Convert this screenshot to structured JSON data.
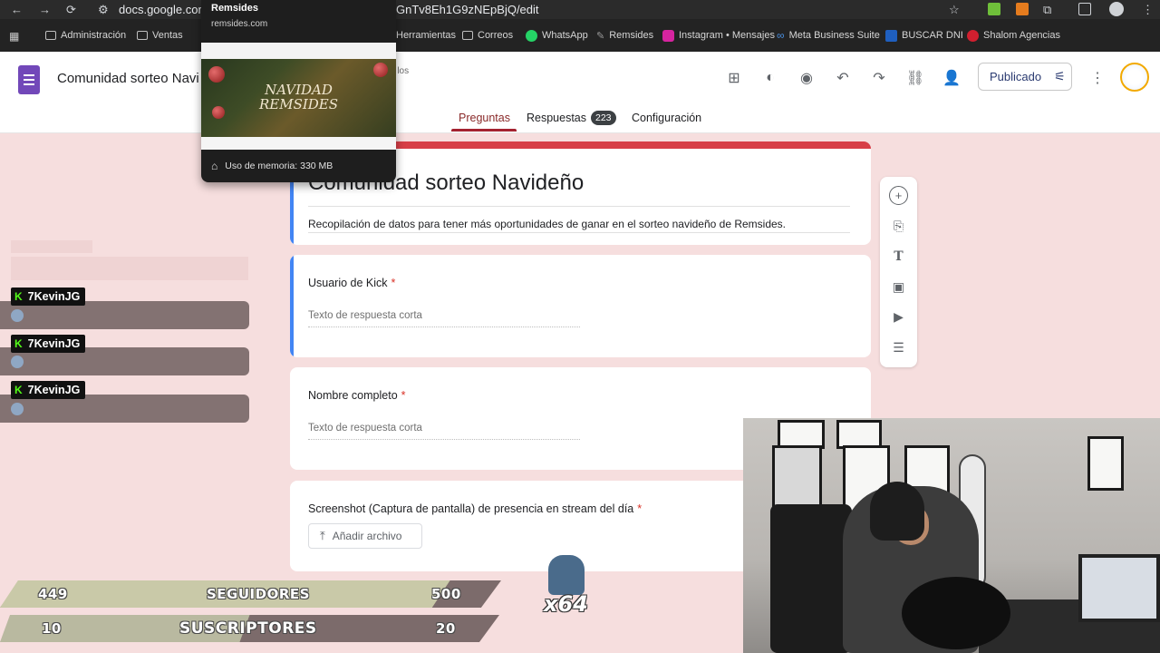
{
  "browser": {
    "url_prefix": "docs.google.com/",
    "url_suffix": "GnTv8Eh1G9zNEpBjQ/edit",
    "bookmarks": [
      {
        "label": "Administración",
        "icon": "folder-icon"
      },
      {
        "label": "Ventas",
        "icon": "folder-icon"
      },
      {
        "label": "Herramientas",
        "icon": "folder-icon"
      },
      {
        "label": "Correos",
        "icon": "folder-icon"
      },
      {
        "label": "WhatsApp",
        "icon": "whatsapp-icon"
      },
      {
        "label": "Remsides",
        "icon": "remsides-icon"
      },
      {
        "label": "Instagram • Mensajes",
        "icon": "instagram-icon"
      },
      {
        "label": "Meta Business Suite",
        "icon": "meta-icon"
      },
      {
        "label": "BUSCAR DNI",
        "icon": "dni-icon"
      },
      {
        "label": "Shalom Agencias",
        "icon": "shalom-icon"
      }
    ]
  },
  "tab_preview": {
    "title": "Remsides",
    "url": "remsides.com",
    "banner_line1": "NAVIDAD",
    "banner_line2": "REMSIDES",
    "memory": "Uso de memoria: 330 MB"
  },
  "forms_header": {
    "doc_title": "Comunidad sorteo Navi",
    "doc_sub": "os los",
    "publish_label": "Publicado",
    "tabs": {
      "questions": "Preguntas",
      "responses": "Respuestas",
      "responses_count": "223",
      "settings": "Configuración"
    }
  },
  "form": {
    "title": "Comunidad sorteo Navideño",
    "description": "Recopilación de datos para tener más oportunidades de ganar en el sorteo navideño de Remsides.",
    "questions": [
      {
        "label": "Usuario de Kick",
        "required": "*",
        "placeholder": "Texto de respuesta corta"
      },
      {
        "label": "Nombre completo",
        "required": "*",
        "placeholder": "Texto de respuesta corta"
      },
      {
        "label": "Screenshot (Captura de pantalla) de presencia en stream del día",
        "required": "*",
        "button": "Añadir archivo"
      }
    ]
  },
  "side_toolbar": [
    "add-question-icon",
    "import-questions-icon",
    "add-title-icon",
    "add-image-icon",
    "add-video-icon",
    "add-section-icon"
  ],
  "stream": {
    "chat": [
      {
        "user": "7KevinJG"
      },
      {
        "user": "7KevinJG"
      },
      {
        "user": "7KevinJG"
      }
    ],
    "goals": [
      {
        "current": "449",
        "label": "SEGUIDORES",
        "target": "500",
        "progress": 0.898
      },
      {
        "current": "10",
        "label": "SUSCRIPTORES",
        "target": "20",
        "progress": 0.5
      }
    ],
    "emote_count": "x64"
  },
  "colors": {
    "form_accent": "#d73f47",
    "focus_bar": "#4285f4",
    "tab_active": "#a42230",
    "page_bg": "#f6dede"
  }
}
